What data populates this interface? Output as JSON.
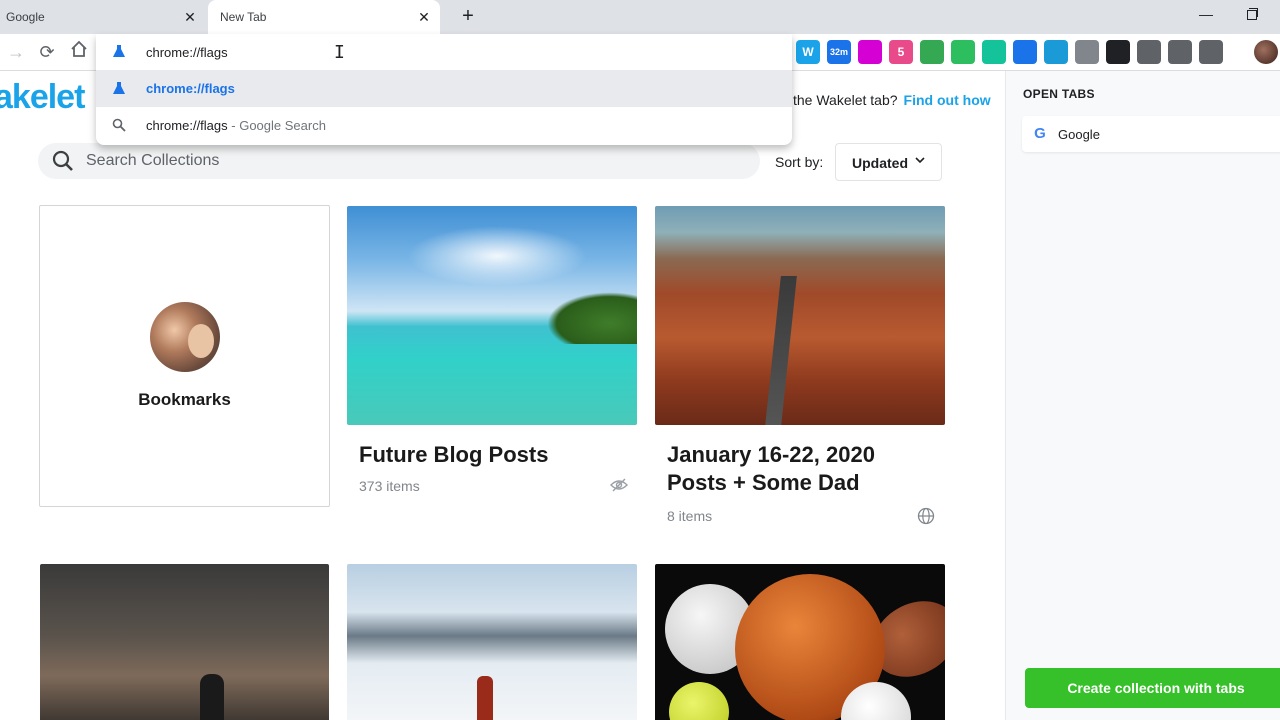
{
  "browser": {
    "tabs": [
      {
        "title": "Google"
      },
      {
        "title": "New Tab"
      }
    ],
    "omnibox": {
      "input_value": "chrome://flags",
      "suggestions": [
        {
          "label": "chrome://flags",
          "suffix": ""
        },
        {
          "label": "chrome://flags",
          "suffix": " - Google Search"
        }
      ]
    },
    "extensions": [
      {
        "icon": "wakelet-w-icon",
        "label": "W",
        "color": "#1aa3e8"
      },
      {
        "icon": "stats-32m-icon",
        "label": "32m",
        "color": "#1a73e8"
      },
      {
        "icon": "square-icon",
        "label": "",
        "color": "#d400d4"
      },
      {
        "icon": "puzzle-5-icon",
        "label": "5",
        "color": "#e84a8a"
      },
      {
        "icon": "green-box-icon",
        "label": "",
        "color": "#34a853"
      },
      {
        "icon": "evernote-icon",
        "label": "",
        "color": "#2dbe60"
      },
      {
        "icon": "grammar-icon",
        "label": "",
        "color": "#15c39a"
      },
      {
        "icon": "pencil-icon",
        "label": "",
        "color": "#1a73e8"
      },
      {
        "icon": "camera-icon",
        "label": "",
        "color": "#1a9bd7"
      },
      {
        "icon": "document-icon",
        "label": "",
        "color": "#80868b"
      },
      {
        "icon": "b-icon",
        "label": "",
        "color": "#202124"
      },
      {
        "icon": "screen-icon",
        "label": "",
        "color": "#5f6368"
      },
      {
        "icon": "y-icon",
        "label": "",
        "color": "#5f6368"
      },
      {
        "icon": "gear-ext-icon",
        "label": "",
        "color": "#5f6368"
      }
    ]
  },
  "page": {
    "brand": "akelet",
    "promo": {
      "text": "the Wakelet tab?",
      "link": "Find out how"
    },
    "search": {
      "placeholder": "Search Collections"
    },
    "sort": {
      "label": "Sort by:",
      "value": "Updated"
    },
    "collections": [
      {
        "title": "Bookmarks",
        "count": ""
      },
      {
        "title": "Future Blog Posts",
        "count": "373 items",
        "visibility": "hidden"
      },
      {
        "title": "January 16-22, 2020 Posts + Some Dad",
        "count": "8 items",
        "visibility": "public"
      }
    ]
  },
  "side_panel": {
    "title": "OPEN TABS",
    "tabs": [
      {
        "title": "Google"
      }
    ],
    "create_button": "Create collection with tabs"
  },
  "colors": {
    "brand": "#1aa3e8",
    "create_button": "#36c02a",
    "link": "#1a73e8"
  }
}
